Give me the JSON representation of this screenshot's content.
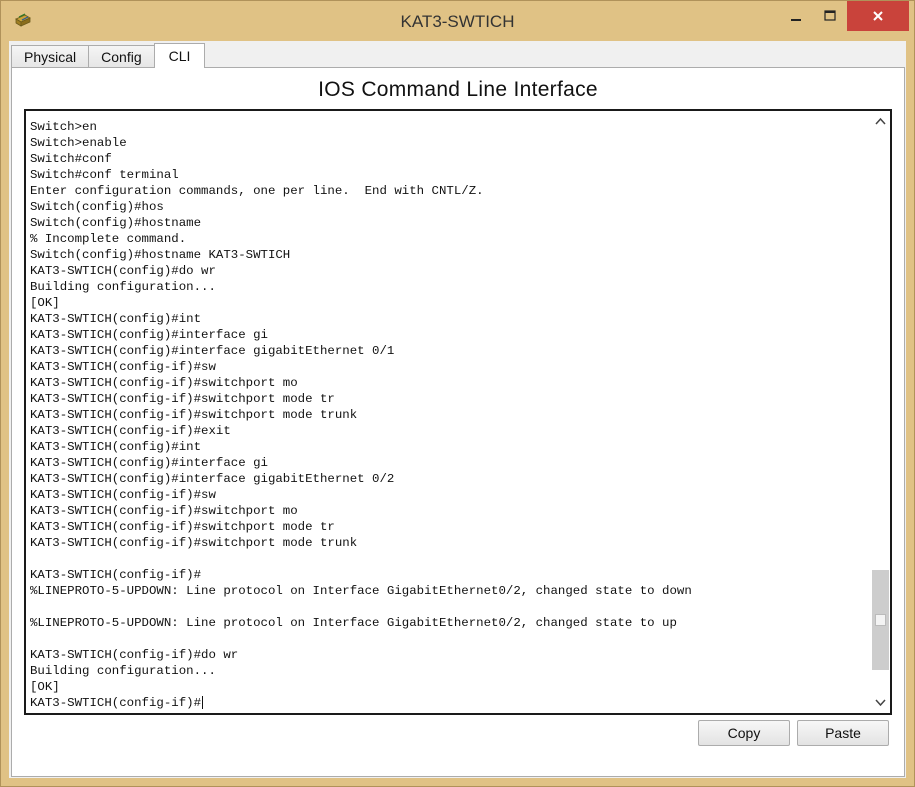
{
  "window": {
    "title": "KAT3-SWTICH",
    "minimize_icon": "minimize-icon",
    "maximize_icon": "maximize-icon",
    "close_icon": "close-icon",
    "close_color": "#c9433b",
    "frame_color": "#e0c285"
  },
  "tabs": [
    {
      "label": "Physical",
      "active": false
    },
    {
      "label": "Config",
      "active": false
    },
    {
      "label": "CLI",
      "active": true
    }
  ],
  "cli": {
    "title": "IOS Command Line Interface",
    "lines": [
      "Switch>en",
      "Switch>enable",
      "Switch#conf",
      "Switch#conf terminal",
      "Enter configuration commands, one per line.  End with CNTL/Z.",
      "Switch(config)#hos",
      "Switch(config)#hostname",
      "% Incomplete command.",
      "Switch(config)#hostname KAT3-SWTICH",
      "KAT3-SWTICH(config)#do wr",
      "Building configuration...",
      "[OK]",
      "KAT3-SWTICH(config)#int",
      "KAT3-SWTICH(config)#interface gi",
      "KAT3-SWTICH(config)#interface gigabitEthernet 0/1",
      "KAT3-SWTICH(config-if)#sw",
      "KAT3-SWTICH(config-if)#switchport mo",
      "KAT3-SWTICH(config-if)#switchport mode tr",
      "KAT3-SWTICH(config-if)#switchport mode trunk",
      "KAT3-SWTICH(config-if)#exit",
      "KAT3-SWTICH(config)#int",
      "KAT3-SWTICH(config)#interface gi",
      "KAT3-SWTICH(config)#interface gigabitEthernet 0/2",
      "KAT3-SWTICH(config-if)#sw",
      "KAT3-SWTICH(config-if)#switchport mo",
      "KAT3-SWTICH(config-if)#switchport mode tr",
      "KAT3-SWTICH(config-if)#switchport mode trunk",
      "",
      "KAT3-SWTICH(config-if)#",
      "%LINEPROTO-5-UPDOWN: Line protocol on Interface GigabitEthernet0/2, changed state to down",
      "",
      "%LINEPROTO-5-UPDOWN: Line protocol on Interface GigabitEthernet0/2, changed state to up",
      "",
      "KAT3-SWTICH(config-if)#do wr",
      "Building configuration...",
      "[OK]",
      "KAT3-SWTICH(config-if)#"
    ],
    "scroll_position": 0.95
  },
  "buttons": {
    "copy": "Copy",
    "paste": "Paste"
  }
}
